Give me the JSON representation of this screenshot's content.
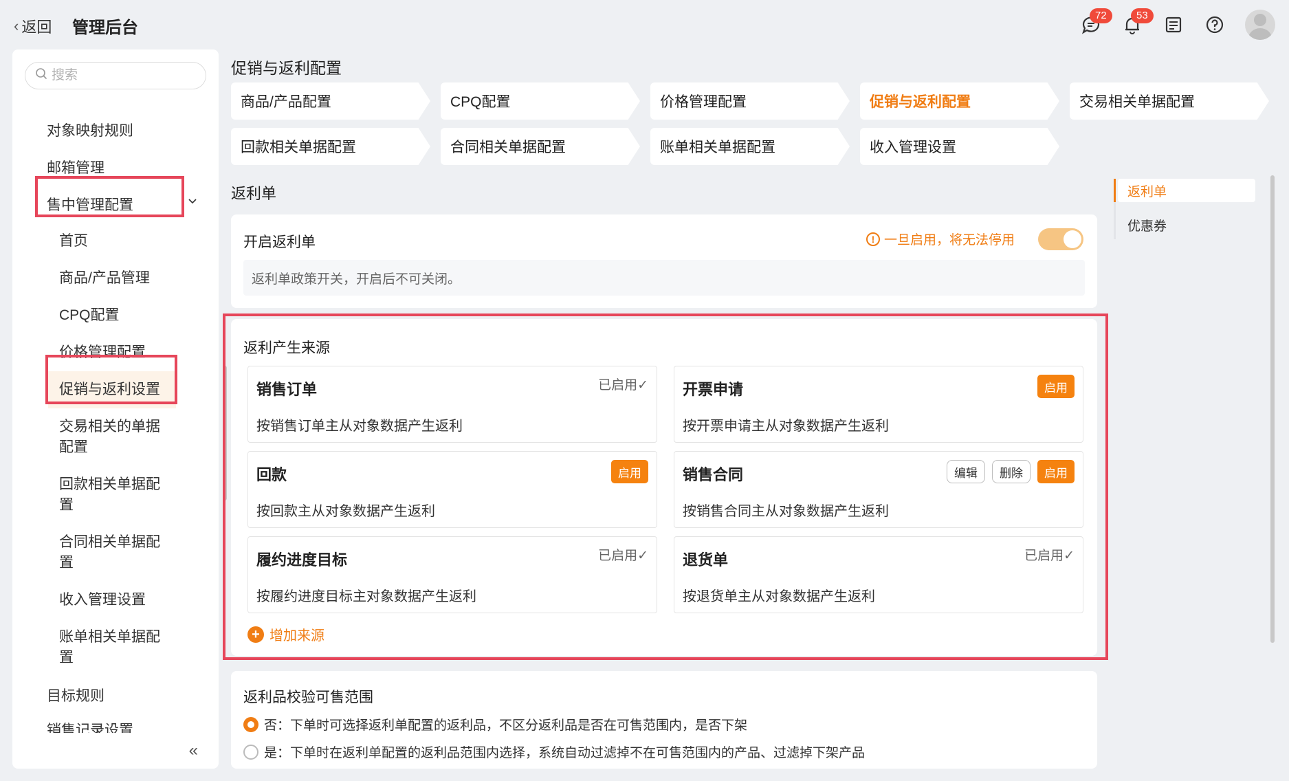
{
  "header": {
    "back_label": "返回",
    "title": "管理后台",
    "message_badge": "72",
    "notification_badge": "53"
  },
  "sidebar": {
    "search_placeholder": "搜索",
    "items": {
      "object_mapping": "对象映射规则",
      "mailbox": "邮箱管理",
      "sales_mgmt": "售中管理配置",
      "home": "首页",
      "product_mgmt": "商品/产品管理",
      "cpq": "CPQ配置",
      "price_mgmt": "价格管理配置",
      "promo_rebate": "促销与返利设置",
      "trade_docs": "交易相关的单据配置",
      "payment_docs": "回款相关单据配置",
      "contract_docs": "合同相关单据配置",
      "revenue": "收入管理设置",
      "bill_docs": "账单相关单据配置",
      "target_rules": "目标规则",
      "sales_record": "销售记录设置"
    }
  },
  "main": {
    "page_title": "促销与返利配置",
    "tabs": [
      "商品/产品配置",
      "CPQ配置",
      "价格管理配置",
      "促销与返利配置",
      "交易相关单据配置",
      "回款相关单据配置",
      "合同相关单据配置",
      "账单相关单据配置",
      "收入管理设置"
    ],
    "active_tab_index": 3,
    "rebate_section_title": "返利单",
    "enable_card": {
      "title": "开启返利单",
      "warning": "一旦启用，将无法停用",
      "description": "返利单政策开关，开启后不可关闭。",
      "enabled": true
    },
    "sources": {
      "title": "返利产生来源",
      "items": [
        {
          "name": "销售订单",
          "desc": "按销售订单主从对象数据产生返利",
          "status": "已启用✓"
        },
        {
          "name": "开票申请",
          "desc": "按开票申请主从对象数据产生返利",
          "enable": "启用"
        },
        {
          "name": "回款",
          "desc": "按回款主从对象数据产生返利",
          "enable": "启用"
        },
        {
          "name": "销售合同",
          "desc": "按销售合同主从对象数据产生返利",
          "edit": "编辑",
          "delete": "删除",
          "enable": "启用"
        },
        {
          "name": "履约进度目标",
          "desc": "按履约进度目标主对象数据产生返利",
          "status": "已启用✓"
        },
        {
          "name": "退货单",
          "desc": "按退货单主从对象数据产生返利",
          "status": "已启用✓"
        }
      ],
      "add_label": "增加来源"
    },
    "scope_card": {
      "title": "返利品校验可售范围",
      "option_no": "否：下单时可选择返利单配置的返利品，不区分返利品是否在可售范围内，是否下架",
      "option_yes": "是：下单时在返利单配置的返利品范围内选择，系统自动过滤掉不在可售范围内的产品、过滤掉下架产品",
      "selected": "no"
    }
  },
  "anchor": {
    "items": [
      "返利单",
      "优惠券"
    ],
    "active_index": 0
  },
  "colors": {
    "accent": "#f07d14",
    "highlight_box": "#e6465a",
    "badge": "#f04a3a"
  }
}
